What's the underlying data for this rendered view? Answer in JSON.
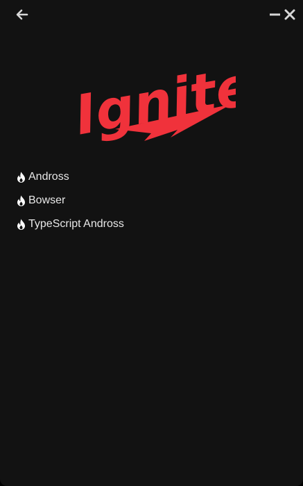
{
  "window": {
    "background": "#121212",
    "icon_color": "#d7d7d7"
  },
  "titlebar": {
    "back_icon": "arrow-left-icon",
    "minimize_icon": "minimize-icon",
    "close_icon": "close-icon"
  },
  "logo": {
    "text": "Ignite",
    "color": "#f0323b",
    "icon": "lightning-bolt-icon"
  },
  "menu": {
    "item_icon": "flame-icon",
    "items": [
      {
        "label": "Andross"
      },
      {
        "label": "Bowser"
      },
      {
        "label": "TypeScript Andross"
      }
    ]
  }
}
